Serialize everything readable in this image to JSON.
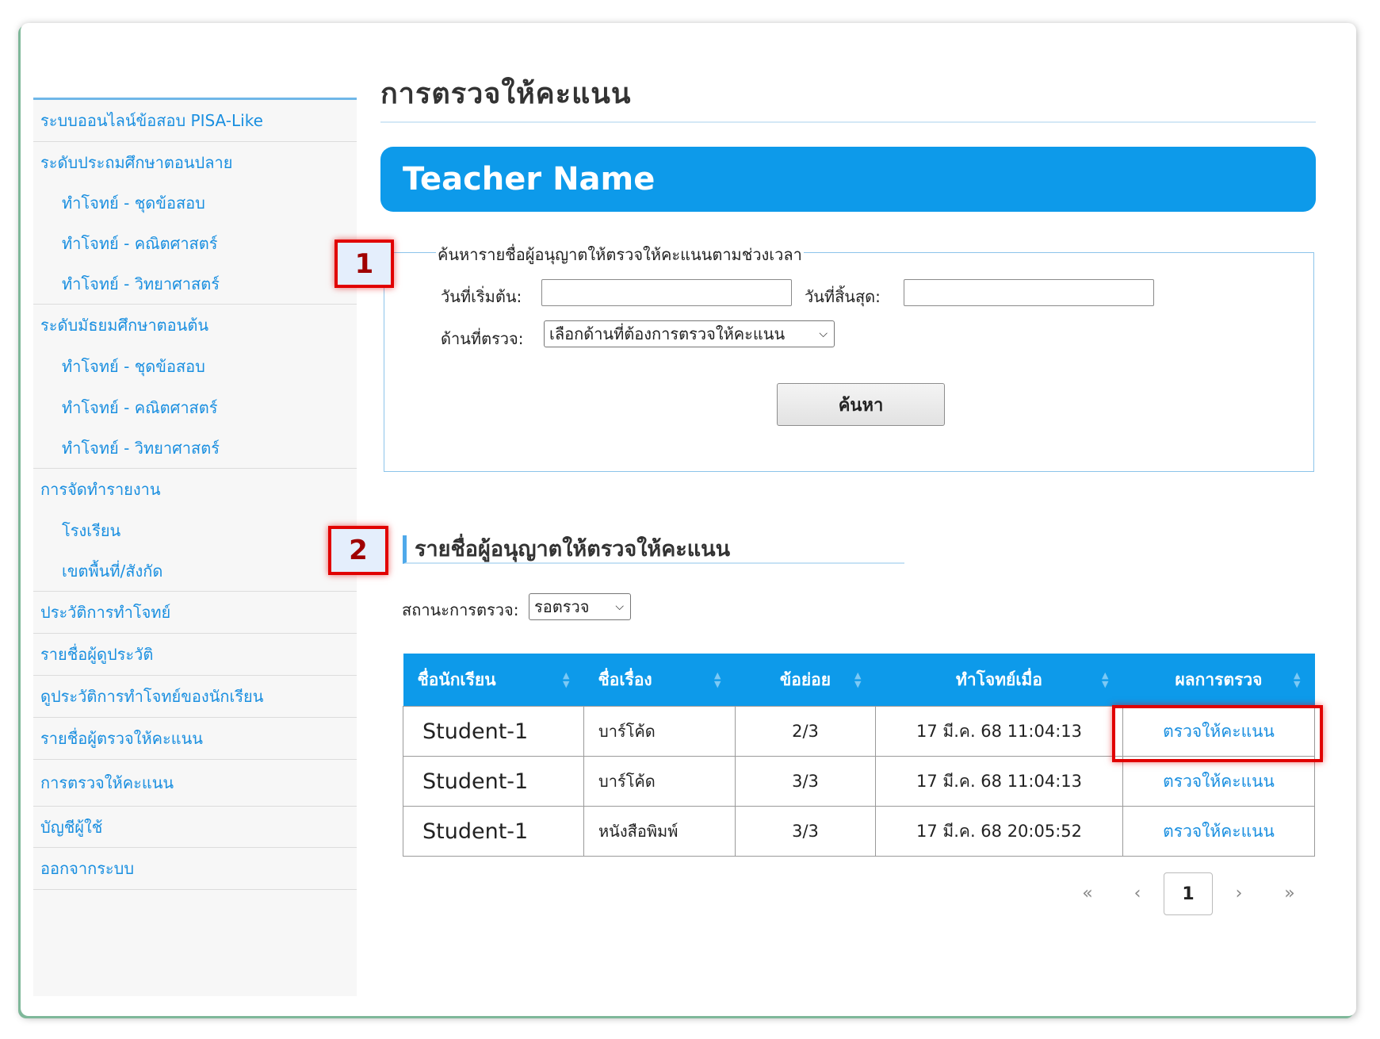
{
  "page": {
    "title": "การตรวจให้คะแนน",
    "teacher_name": "Teacher Name"
  },
  "sidebar": {
    "items": [
      {
        "label": "ระบบออนไลน์ข้อสอบ PISA-Like",
        "level": 0
      },
      {
        "label": "ระดับประถมศึกษาตอนปลาย",
        "level": 0
      },
      {
        "label": "ทำโจทย์ - ชุดข้อสอบ",
        "level": 1
      },
      {
        "label": "ทำโจทย์ - คณิตศาสตร์",
        "level": 1
      },
      {
        "label": "ทำโจทย์ - วิทยาศาสตร์",
        "level": 1
      },
      {
        "label": "ระดับมัธยมศึกษาตอนต้น",
        "level": 0
      },
      {
        "label": "ทำโจทย์ - ชุดข้อสอบ",
        "level": 1
      },
      {
        "label": "ทำโจทย์ - คณิตศาสตร์",
        "level": 1
      },
      {
        "label": "ทำโจทย์ - วิทยาศาสตร์",
        "level": 1
      },
      {
        "label": "การจัดทำรายงาน",
        "level": 0
      },
      {
        "label": "โรงเรียน",
        "level": 1
      },
      {
        "label": "เขตพื้นที่/สังกัด",
        "level": 1
      },
      {
        "label": "ประวัติการทำโจทย์",
        "level": 0
      },
      {
        "label": "รายชื่อผู้ดูประวัติ",
        "level": 0
      },
      {
        "label": "ดูประวัติการทำโจทย์ของนักเรียน",
        "level": 0
      },
      {
        "label": "รายชื่อผู้ตรวจให้คะแนน",
        "level": 0
      },
      {
        "label": "การตรวจให้คะแนน",
        "level": 0
      },
      {
        "label": "บัญชีผู้ใช้",
        "level": 0
      },
      {
        "label": "ออกจากระบบ",
        "level": 0
      }
    ]
  },
  "search": {
    "legend": "ค้นหารายชื่อผู้อนุญาตให้ตรวจให้คะแนนตามช่วงเวลา",
    "start_date_label": "วันที่เริ่มต้น:",
    "start_date_value": "",
    "end_date_label": "วันที่สิ้นสุด:",
    "end_date_value": "",
    "aspect_label": "ด้านที่ตรวจ:",
    "aspect_selected": "เลือกด้านที่ต้องการตรวจให้คะแนน",
    "button_label": "ค้นหา"
  },
  "results": {
    "title": "รายชื่อผู้อนุญาตให้ตรวจให้คะแนน",
    "status_label": "สถานะการตรวจ:",
    "status_selected": "รอตรวจ",
    "columns": [
      "ชื่อนักเรียน",
      "ชื่อเรื่อง",
      "ข้อย่อย",
      "ทำโจทย์เมื่อ",
      "ผลการตรวจ"
    ],
    "rows": [
      {
        "student": "Student-1",
        "subject": "บาร์โค้ด",
        "item": "2/3",
        "submitted": "17 มี.ค. 68 11:04:13",
        "action": "ตรวจให้คะแนน"
      },
      {
        "student": "Student-1",
        "subject": "บาร์โค้ด",
        "item": "3/3",
        "submitted": "17 มี.ค. 68 11:04:13",
        "action": "ตรวจให้คะแนน"
      },
      {
        "student": "Student-1",
        "subject": "หนังสือพิมพ์",
        "item": "3/3",
        "submitted": "17 มี.ค. 68 20:05:52",
        "action": "ตรวจให้คะแนน"
      }
    ]
  },
  "pagination": {
    "first": "«",
    "prev": "‹",
    "current": "1",
    "next": "›",
    "last": "»"
  },
  "callouts": {
    "one": "1",
    "two": "2"
  },
  "colors": {
    "accent": "#0d9aea",
    "link": "#1a8fe0",
    "callout": "#e10000"
  },
  "icons": {
    "sort": "sort-arrows-icon",
    "chevron": "chevron-down-icon"
  }
}
